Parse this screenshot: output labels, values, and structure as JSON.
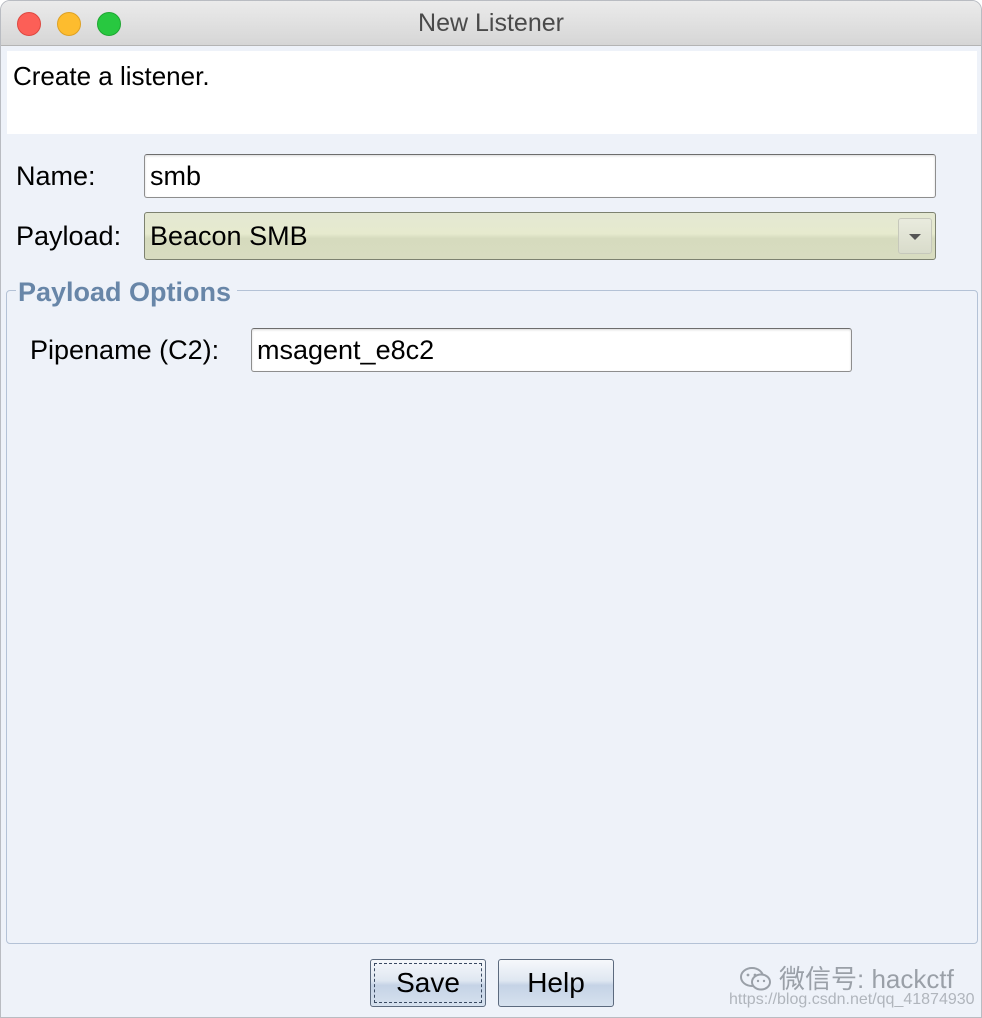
{
  "window": {
    "title": "New Listener"
  },
  "header": {
    "text": "Create a listener."
  },
  "form": {
    "name_label": "Name:",
    "name_value": "smb",
    "payload_label": "Payload:",
    "payload_value": "Beacon SMB"
  },
  "payload_options": {
    "title": "Payload Options",
    "pipename_label": "Pipename (C2):",
    "pipename_value": "msagent_e8c2"
  },
  "buttons": {
    "save_label": "Save",
    "help_label": "Help"
  },
  "watermark": {
    "text": "微信号: hackctf",
    "url": "https://blog.csdn.net/qq_41874930"
  }
}
